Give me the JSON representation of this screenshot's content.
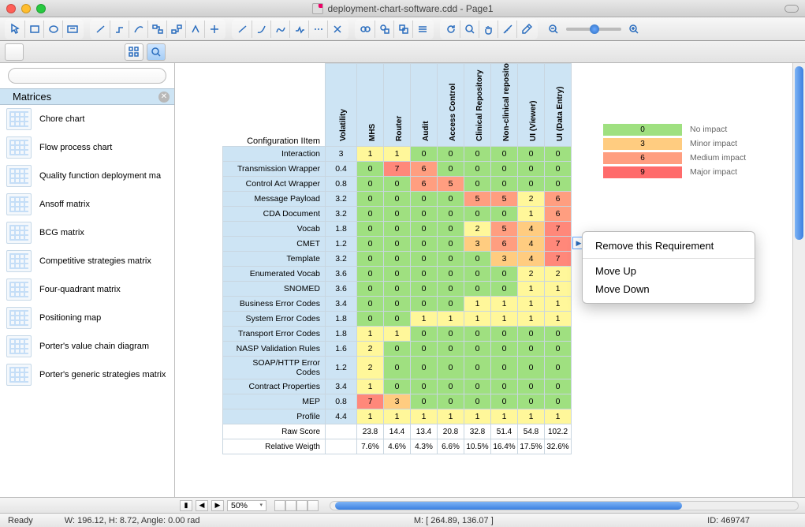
{
  "window_title": "deployment-chart-software.cdd - Page1",
  "sidebar": {
    "panel_title": "Matrices",
    "search_placeholder": "",
    "items": [
      {
        "label": "Chore chart"
      },
      {
        "label": "Flow process chart"
      },
      {
        "label": "Quality function deployment ma"
      },
      {
        "label": "Ansoff matrix"
      },
      {
        "label": "BCG matrix"
      },
      {
        "label": "Competitive strategies matrix"
      },
      {
        "label": "Four-quadrant matrix"
      },
      {
        "label": "Positioning map"
      },
      {
        "label": "Porter's value chain diagram"
      },
      {
        "label": "Porter's generic strategies matrix"
      }
    ]
  },
  "chart_data": {
    "type": "heatmap",
    "title": "Configuration IItem",
    "columns": [
      "Volatility",
      "MHS",
      "Router",
      "Audit",
      "Access Control",
      "Clinical Repository",
      "Non-clinical repository",
      "UI (Viewer)",
      "UI (Data Entry)"
    ],
    "rows": [
      {
        "label": "Interaction",
        "vol": "3",
        "v": [
          1,
          1,
          0,
          0,
          0,
          0,
          0,
          0
        ]
      },
      {
        "label": "Transmission Wrapper",
        "vol": "0.4",
        "v": [
          0,
          7,
          6,
          0,
          0,
          0,
          0,
          0
        ]
      },
      {
        "label": "Control Act Wrapper",
        "vol": "0.8",
        "v": [
          0,
          0,
          6,
          5,
          0,
          0,
          0,
          0
        ]
      },
      {
        "label": "Message Payload",
        "vol": "3.2",
        "v": [
          0,
          0,
          0,
          0,
          5,
          5,
          2,
          6
        ]
      },
      {
        "label": "CDA Document",
        "vol": "3.2",
        "v": [
          0,
          0,
          0,
          0,
          0,
          0,
          1,
          6
        ]
      },
      {
        "label": "Vocab",
        "vol": "1.8",
        "v": [
          0,
          0,
          0,
          0,
          2,
          5,
          4,
          7
        ]
      },
      {
        "label": "CMET",
        "vol": "1.2",
        "v": [
          0,
          0,
          0,
          0,
          3,
          6,
          4,
          7
        ]
      },
      {
        "label": "Template",
        "vol": "3.2",
        "v": [
          0,
          0,
          0,
          0,
          0,
          3,
          4,
          7
        ]
      },
      {
        "label": "Enumerated Vocab",
        "vol": "3.6",
        "v": [
          0,
          0,
          0,
          0,
          0,
          0,
          2,
          2
        ]
      },
      {
        "label": "SNOMED",
        "vol": "3.6",
        "v": [
          0,
          0,
          0,
          0,
          0,
          0,
          1,
          1
        ]
      },
      {
        "label": "Business Error Codes",
        "vol": "3.4",
        "v": [
          0,
          0,
          0,
          0,
          1,
          1,
          1,
          1
        ]
      },
      {
        "label": "System Error Codes",
        "vol": "1.8",
        "v": [
          0,
          0,
          1,
          1,
          1,
          1,
          1,
          1
        ]
      },
      {
        "label": "Transport Error Codes",
        "vol": "1.8",
        "v": [
          1,
          1,
          0,
          0,
          0,
          0,
          0,
          0
        ]
      },
      {
        "label": "NASP Validation Rules",
        "vol": "1.6",
        "v": [
          2,
          0,
          0,
          0,
          0,
          0,
          0,
          0
        ]
      },
      {
        "label": "SOAP/HTTP Error Codes",
        "vol": "1.2",
        "v": [
          2,
          0,
          0,
          0,
          0,
          0,
          0,
          0
        ]
      },
      {
        "label": "Contract Properties",
        "vol": "3.4",
        "v": [
          1,
          0,
          0,
          0,
          0,
          0,
          0,
          0
        ]
      },
      {
        "label": "MEP",
        "vol": "0.8",
        "v": [
          7,
          3,
          0,
          0,
          0,
          0,
          0,
          0
        ]
      },
      {
        "label": "Profile",
        "vol": "4.4",
        "v": [
          1,
          1,
          1,
          1,
          1,
          1,
          1,
          1
        ]
      }
    ],
    "totals": [
      {
        "label": "Raw Score",
        "v": [
          "23.8",
          "14.4",
          "13.4",
          "20.8",
          "32.8",
          "51.4",
          "54.8",
          "102.2"
        ]
      },
      {
        "label": "Relative Weigth",
        "v": [
          "7.6%",
          "4.6%",
          "4.3%",
          "6.6%",
          "10.5%",
          "16.4%",
          "17.5%",
          "32.6%"
        ]
      }
    ]
  },
  "legend": {
    "rows": [
      {
        "value": "0",
        "label": "No impact",
        "color": "#9fe080"
      },
      {
        "value": "3",
        "label": "Minor impact",
        "color": "#ffcc80"
      },
      {
        "value": "6",
        "label": "Medium impact",
        "color": "#ff9e80"
      },
      {
        "value": "9",
        "label": "Major impact",
        "color": "#ff6b6b"
      }
    ]
  },
  "context_menu": {
    "items": [
      "Remove this Requirement",
      "Move Up",
      "Move Down"
    ]
  },
  "zoom_percent": "50%",
  "status": {
    "ready": "Ready",
    "dims": "W: 196.12,  H: 8.72,  Angle: 0.00 rad",
    "mouse": "M: [ 264.89, 136.07 ]",
    "id": "ID: 469747"
  },
  "colors": {
    "accent": "#2a6dbe",
    "panel": "#cde4f4"
  }
}
